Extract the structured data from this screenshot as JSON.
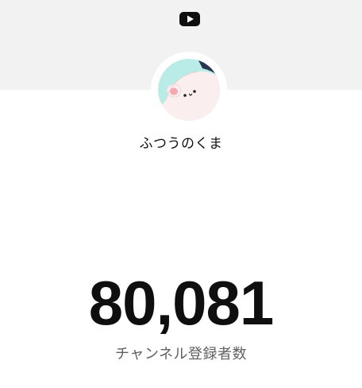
{
  "header": {
    "logo_icon": "youtube-play-icon",
    "background": "#f2f2f2"
  },
  "channel": {
    "name": "ふつうのくま",
    "avatar_icon": "bear-avatar"
  },
  "stats": {
    "subscriber_count": "80,081",
    "subscriber_label": "チャンネル登録者数"
  },
  "colors": {
    "count_text": "#0f0f0f",
    "label_text": "#606060",
    "avatar_bg_left": "#b9ece6",
    "avatar_bear": "#fbeeee"
  }
}
